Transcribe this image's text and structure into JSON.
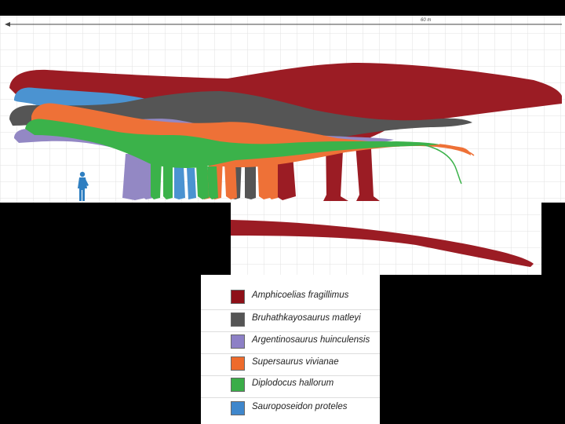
{
  "scale": {
    "label": "60 m"
  },
  "colors": {
    "amphicoelias": "#9b1c24",
    "bruhathkayosaurus": "#555555",
    "argentinosaurus": "#9388c4",
    "supersaurus": "#ee7137",
    "diplodocus": "#3bb24a",
    "sauroposeidon": "#4b93d1",
    "human": "#2f7fc1",
    "grid": "#e4e4e4",
    "background": "#000000"
  },
  "legend": {
    "items": [
      {
        "label": "Amphicoelias fragillimus",
        "color": "#8e1018"
      },
      {
        "label": "Bruhathkayosaurus matleyi",
        "color": "#555555"
      },
      {
        "label": "Argentinosaurus huinculensis",
        "color": "#8d80c6"
      },
      {
        "label": "Supersaurus vivianae",
        "color": "#ee6b2c"
      },
      {
        "label": "Diplodocus hallorum",
        "color": "#3aad48"
      },
      {
        "label": "Sauroposeidon proteles",
        "color": "#3f87cc"
      }
    ]
  }
}
